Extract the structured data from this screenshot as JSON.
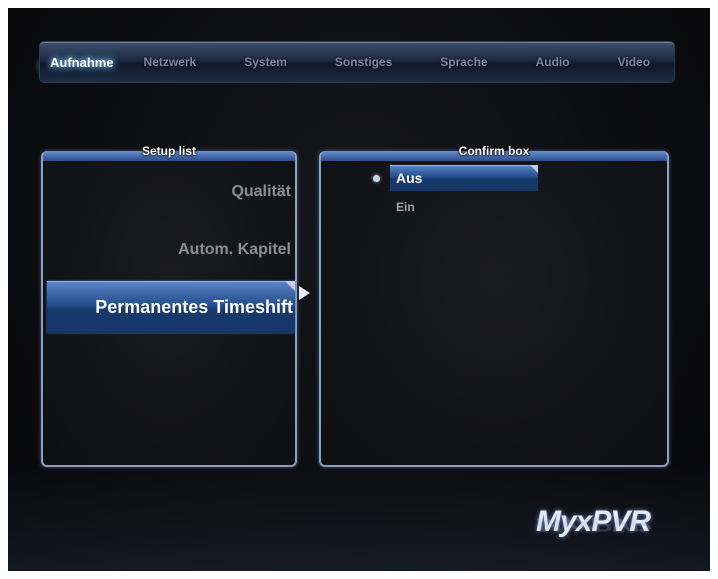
{
  "tabs": [
    {
      "label": "Aufnahme",
      "active": true
    },
    {
      "label": "Netzwerk",
      "active": false
    },
    {
      "label": "System",
      "active": false
    },
    {
      "label": "Sonstiges",
      "active": false
    },
    {
      "label": "Sprache",
      "active": false
    },
    {
      "label": "Audio",
      "active": false
    },
    {
      "label": "Video",
      "active": false
    }
  ],
  "setup_list": {
    "title": "Setup list",
    "items": [
      "Qualität",
      "Autom. Kapitel",
      "Permanentes Timeshift"
    ],
    "selected": "Permanentes Timeshift"
  },
  "confirm_box": {
    "title": "Confirm box",
    "options": [
      "Aus",
      "Ein"
    ],
    "selected": "Aus"
  },
  "logo": {
    "text": "MyxPVR"
  },
  "colors": {
    "highlight": "#244f8f",
    "panel_border": "#8ea0bd",
    "text_dim": "#8b8e95",
    "text_active": "#ffffff"
  },
  "icons": {
    "selection_arrow": "arrow-right-icon",
    "radio": "radio-dot-icon"
  }
}
